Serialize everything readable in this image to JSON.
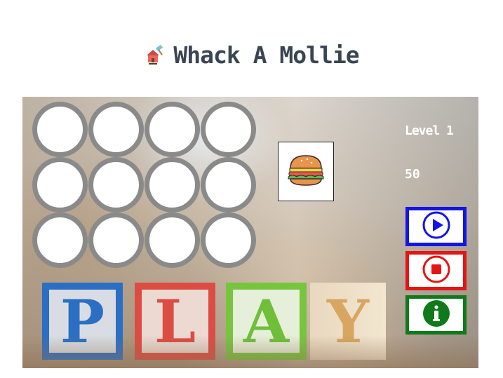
{
  "title": {
    "text": "Whack A Mollie",
    "icon": "house-with-hammer-icon"
  },
  "game": {
    "holes": [
      1,
      2,
      3,
      4,
      5,
      6,
      7,
      8,
      9,
      10,
      11,
      12
    ],
    "target_icon": "hamburger-icon",
    "level_label": "Level 1",
    "score": "50",
    "background_letters": [
      "P",
      "L",
      "A",
      "Y"
    ]
  },
  "controls": {
    "play": {
      "icon": "play-icon",
      "color": "#1414e6"
    },
    "stop": {
      "icon": "stop-icon",
      "color": "#e61414"
    },
    "info": {
      "icon": "info-icon",
      "color": "#0f7a1a"
    }
  }
}
